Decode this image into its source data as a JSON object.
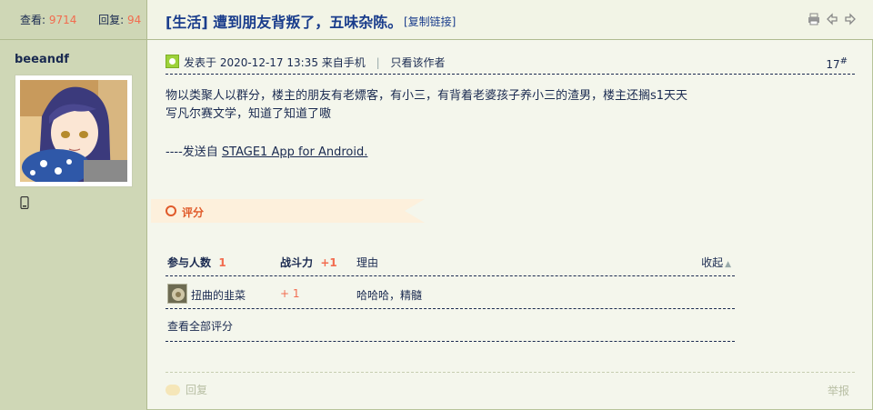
{
  "thread": {
    "views_label": "查看:",
    "views_value": "9714",
    "replies_label": "回复:",
    "replies_value": "94",
    "title": "[生活] 遭到朋友背叛了，五味杂陈。",
    "copy_link": "[复制链接]",
    "icons": [
      "print-icon",
      "prev-thread-icon",
      "next-thread-icon"
    ]
  },
  "author": {
    "name": "beeandf",
    "device_icon": "mobile-phone-icon"
  },
  "post": {
    "meta_posted": "发表于 2020-12-17 13:35 来自手机",
    "meta_separator": "|",
    "only_author": "只看该作者",
    "floor_number": "17",
    "floor_mark": "#",
    "body_line1": "物以类聚人以群分，楼主的朋友有老嫖客，有小三，有背着老婆孩子养小三的渣男，楼主还搁s1天天",
    "body_line2": "写凡尔赛文学，知道了知道了嗷",
    "sign_prefix": "----发送自 ",
    "sign_link": "STAGE1 App for Android."
  },
  "rating": {
    "banner_label": "评分",
    "col_participants": "参与人数",
    "participants_count": "1",
    "col_power": "战斗力",
    "power_total": "+1",
    "col_reason": "理由",
    "collapse": "收起",
    "rows": [
      {
        "user": "扭曲的韭菜",
        "score": "+ 1",
        "reason": "哈哈哈，精髓"
      }
    ],
    "view_all": "查看全部评分"
  },
  "footer": {
    "reply": "回复",
    "report": "举报"
  }
}
